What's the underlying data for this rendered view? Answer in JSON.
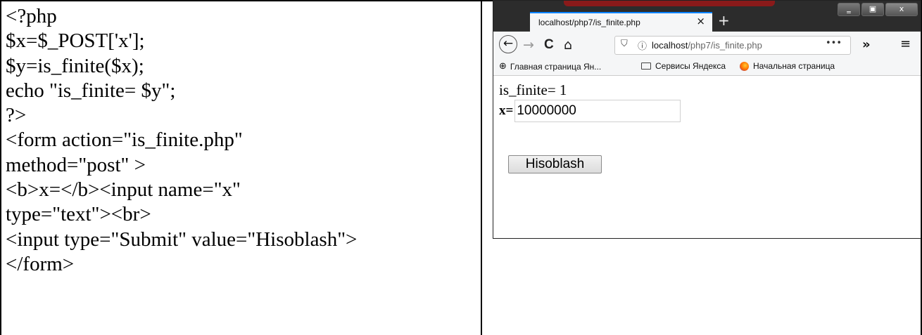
{
  "code": {
    "lines": [
      "<?php",
      "$x=$_POST['x'];",
      "$y=is_finite($x);",
      "echo \"is_finite= $y\";",
      "?>",
      "<form action=\"is_finite.php\"",
      "method=\"post\" >",
      "<b>x=</b><input name=\"x\"",
      "type=\"text\"><br>",
      "<input type=\"Submit\" value=\"Hisoblash\">",
      "</form>"
    ]
  },
  "browser": {
    "tab_title": "localhost/php7/is_finite.php",
    "tab_close": "×",
    "new_tab": "+",
    "window_buttons": {
      "minimize": "‗",
      "maximize": "▣",
      "close": "x"
    },
    "nav": {
      "back": "←",
      "forward": "→",
      "reload": "C",
      "home": "⌂"
    },
    "url": {
      "host": "localhost",
      "path": "/php7/is_finite.php",
      "more": "•••"
    },
    "overflow": "»",
    "menu": "≡",
    "bookmarks": [
      {
        "label": "Главная страница Ян...",
        "icon": "globe-icon"
      },
      {
        "label": "Сервисы Яндекса",
        "icon": "folder-icon"
      },
      {
        "label": "Начальная страница",
        "icon": "firefox-icon"
      }
    ],
    "page": {
      "output": "is_finite= 1",
      "x_label": "x=",
      "x_value": "10000000",
      "submit_label": "Hisoblash"
    }
  }
}
